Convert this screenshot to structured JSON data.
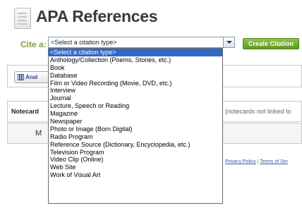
{
  "header": {
    "title": "APA References"
  },
  "cite": {
    "label": "Cite a:",
    "selected": "<Select a citation type>",
    "button": "Create Citation"
  },
  "behind": {
    "tab_label": "Anal",
    "notecards_label": "Notecard",
    "notecards_note": "(notecards not linked to",
    "m_letter": "M",
    "privacy": "Privacy Policy",
    "sep": "|",
    "terms": "Terms of Ser"
  },
  "dropdown": {
    "options": [
      "<Select a citation type>",
      "Anthology/Collection (Poems, Stories, etc.)",
      "Book",
      "Database",
      "Film or Video Recording (Movie, DVD, etc.)",
      "Interview",
      "Journal",
      "Lecture, Speech or Reading",
      "Magazine",
      "Newspaper",
      "Photo or Image (Born Digital)",
      "Radio Program",
      "Reference Source (Dictionary, Encyclopedia, etc.)",
      "Television Program",
      "Video Clip (Online)",
      "Web Site",
      "Work of Visual Art"
    ],
    "selected_index": 0
  },
  "colors": {
    "accent_green": "#7aa23a",
    "selection_blue": "#3169c6"
  },
  "icons": [
    "document-icon",
    "dropdown-arrow-icon",
    "chart-icon"
  ]
}
